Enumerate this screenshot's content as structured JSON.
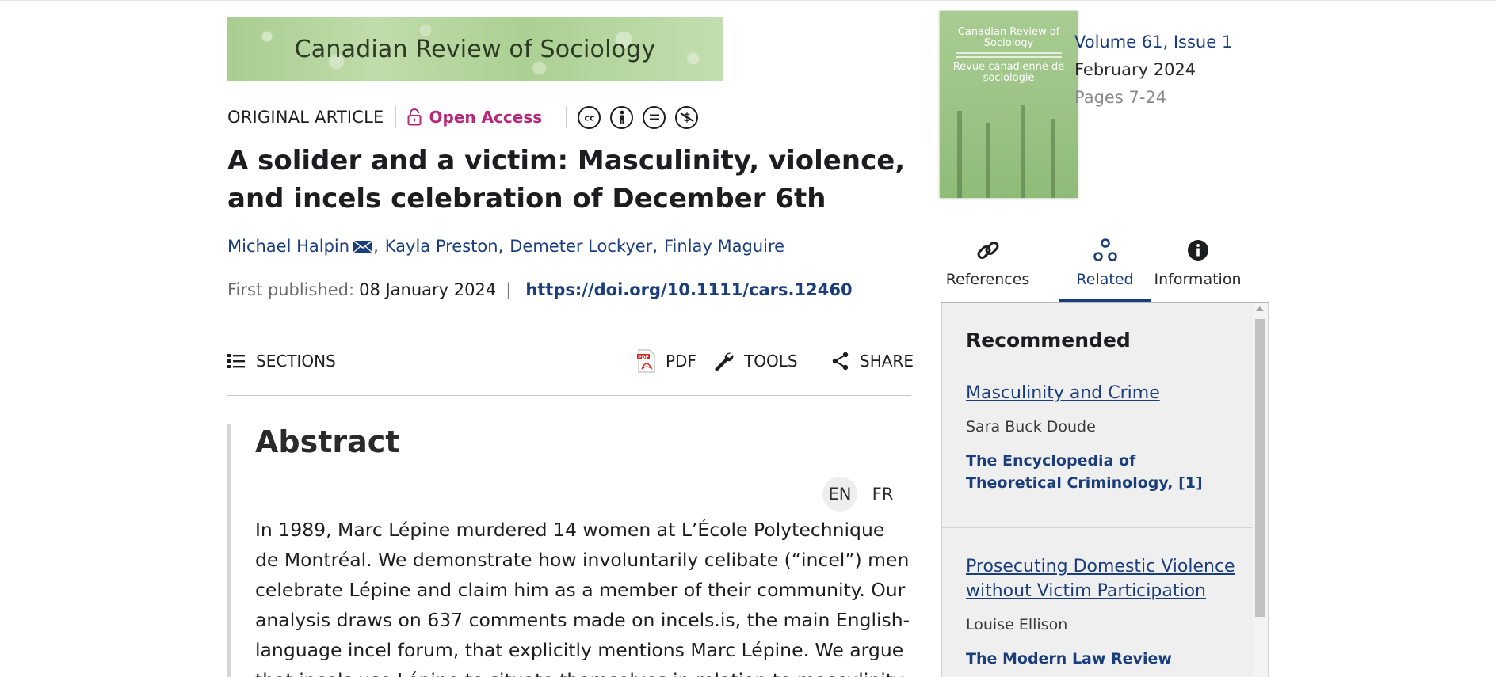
{
  "journal": {
    "banner_title": "Canadian Review of Sociology"
  },
  "article": {
    "type": "ORIGINAL ARTICLE",
    "access": "Open Access",
    "license_icons": [
      "cc-icon",
      "by-icon",
      "nd-icon",
      "nc-icon"
    ],
    "title": "A solider and a victim: Masculinity, violence, and incels celebration of December 6th",
    "authors": [
      "Michael Halpin",
      "Kayla Preston",
      "Demeter Lockyer",
      "Finlay Maguire"
    ],
    "first_published_label": "First published:",
    "first_published_date": "08 January 2024",
    "doi": "https://doi.org/10.1111/cars.12460"
  },
  "toolbar": {
    "sections": "SECTIONS",
    "pdf": "PDF",
    "tools": "TOOLS",
    "share": "SHARE"
  },
  "abstract": {
    "heading": "Abstract",
    "lang_en": "EN",
    "lang_fr": "FR",
    "text": "In 1989, Marc Lépine murdered 14 women at L’École Polytechnique de Montréal. We demonstrate how involuntarily celibate (“incel”) men celebrate Lépine and claim him as a member of their community. Our analysis draws on 637 comments made on incels.is, the main English-language incel forum, that explicitly mentions Marc Lépine. We argue that incels use Lépine to situate themselves in relation to masculinity"
  },
  "issue": {
    "cover_title": "Canadian Review of Sociology",
    "cover_subtitle": "Revue canadienne de sociologie",
    "volume": "Volume 61, Issue 1",
    "month": "February 2024",
    "pages": "Pages 7-24"
  },
  "tabs": [
    {
      "label": "References",
      "icon": "link-icon"
    },
    {
      "label": "Related",
      "icon": "related-icon",
      "active": true
    },
    {
      "label": "Information",
      "icon": "info-icon"
    }
  ],
  "related": {
    "heading": "Recommended",
    "items": [
      {
        "title": "Masculinity and Crime",
        "author": "Sara Buck Doude",
        "journal": "The Encyclopedia of Theoretical Criminology, [1]"
      },
      {
        "title": "Prosecuting Domestic Violence without Victim Participation",
        "author": "Louise Ellison",
        "journal": "The Modern Law Review"
      }
    ]
  },
  "colors": {
    "link_blue": "#1a3d7c",
    "open_access_magenta": "#b5287a",
    "banner_green": "#b5d49e"
  }
}
